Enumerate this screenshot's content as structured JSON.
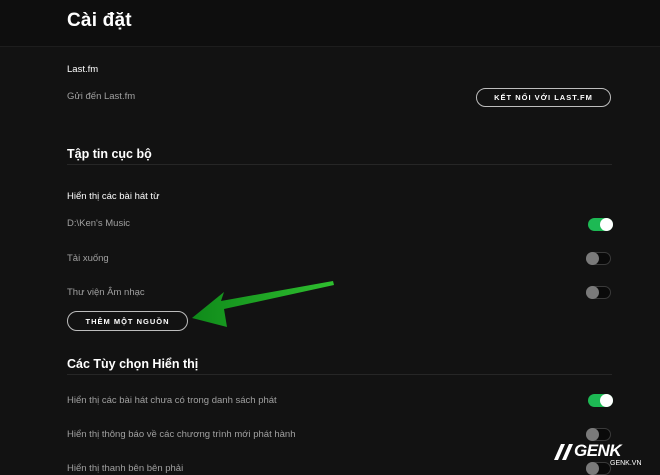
{
  "page": {
    "title": "Cài đặt"
  },
  "lastfm": {
    "heading": "Last.fm",
    "label": "Gửi đến Last.fm",
    "connect_button": "KẾT NỐI VỚI LAST.FM"
  },
  "local_files": {
    "title": "Tập tin cục bộ",
    "subheading": "Hiển thị các bài hát từ",
    "sources": [
      {
        "label": "D:\\Ken's Music",
        "enabled": true
      },
      {
        "label": "Tải xuống",
        "enabled": false
      },
      {
        "label": "Thư viện Âm nhạc",
        "enabled": false
      }
    ],
    "add_source_button": "THÊM MỘT NGUỒN"
  },
  "display_options": {
    "title": "Các Tùy chọn Hiển thị",
    "options": [
      {
        "label": "Hiển thị các bài hát chưa có trong danh sách phát",
        "enabled": true
      },
      {
        "label": "Hiển thị thông báo về các chương trình mới phát hành",
        "enabled": false
      },
      {
        "label": "Hiển thị thanh bên bên phải",
        "enabled": false
      }
    ]
  },
  "annotation": {
    "arrow_color": "#1fa61f"
  },
  "watermark": {
    "logo": "GENK",
    "sub": "GENK.VN"
  },
  "colors": {
    "background": "#121212",
    "accent": "#1db954",
    "text_secondary": "#a0a0a0"
  }
}
